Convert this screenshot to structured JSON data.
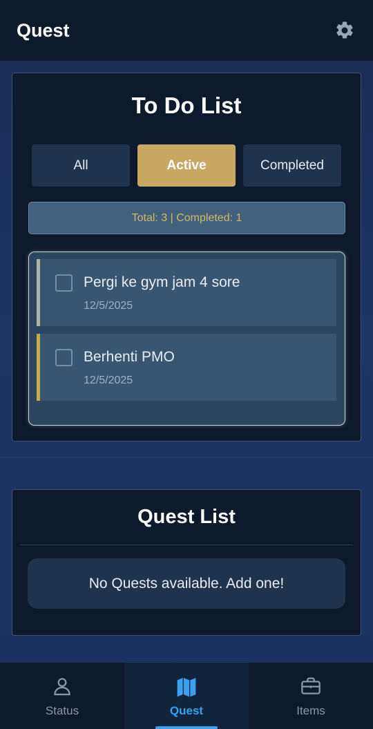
{
  "appbar": {
    "title": "Quest",
    "settings_icon": "gear-icon"
  },
  "todo": {
    "title": "To Do List",
    "filters": [
      {
        "label": "All",
        "active": false
      },
      {
        "label": "Active",
        "active": true
      },
      {
        "label": "Completed",
        "active": false
      }
    ],
    "stats": "Total: 3 | Completed: 1",
    "items": [
      {
        "text": "Pergi ke gym jam 4 sore",
        "date": "12/5/2025",
        "checked": false
      },
      {
        "text": "Berhenti PMO",
        "date": "12/5/2025",
        "checked": false
      }
    ]
  },
  "quests": {
    "title": "Quest List",
    "empty_message": "No Quests available. Add one!"
  },
  "bottom_nav": {
    "items": [
      {
        "label": "Status",
        "icon": "person-icon",
        "active": false
      },
      {
        "label": "Quest",
        "icon": "map-icon",
        "active": true
      },
      {
        "label": "Items",
        "icon": "briefcase-icon",
        "active": false
      }
    ]
  },
  "colors": {
    "accent": "#c8a862",
    "nav_active": "#3aa1f0",
    "background": "#1c3564"
  }
}
